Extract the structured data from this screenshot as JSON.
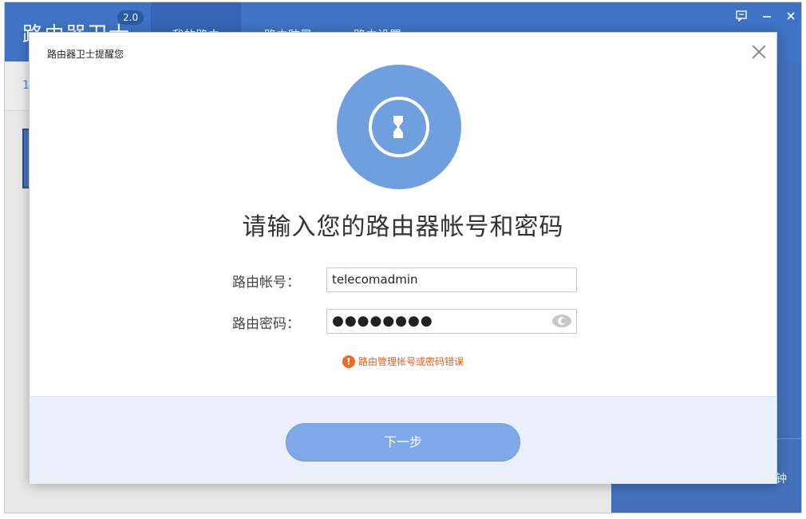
{
  "app": {
    "title": "路由器卫士",
    "version": "2.0",
    "tabs": [
      {
        "label": "我的路由"
      },
      {
        "label": "路由防黑"
      },
      {
        "label": "路由设置"
      }
    ],
    "subbar_text": "1",
    "right_panel_text": "钟"
  },
  "modal": {
    "title": "路由器卫士提醒您",
    "heading": "请输入您的路由器帐号和密码",
    "account_label": "路由帐号：",
    "account_value": "telecomadmin",
    "password_label": "路由密码：",
    "password_value": "●●●●●●●●",
    "error_text": "路由管理帐号或密码错误",
    "next_label": "下一步"
  },
  "colors": {
    "header_blue": "#3f73c5",
    "lock_circle": "#709fe0",
    "error_orange": "#e85f1d",
    "button_blue": "#80a9ea",
    "footer_bg": "#eaf0f9"
  },
  "icons": [
    "lock-icon",
    "eye-icon",
    "error-icon",
    "close-icon",
    "message-icon",
    "minimize-icon",
    "window-close-icon"
  ]
}
